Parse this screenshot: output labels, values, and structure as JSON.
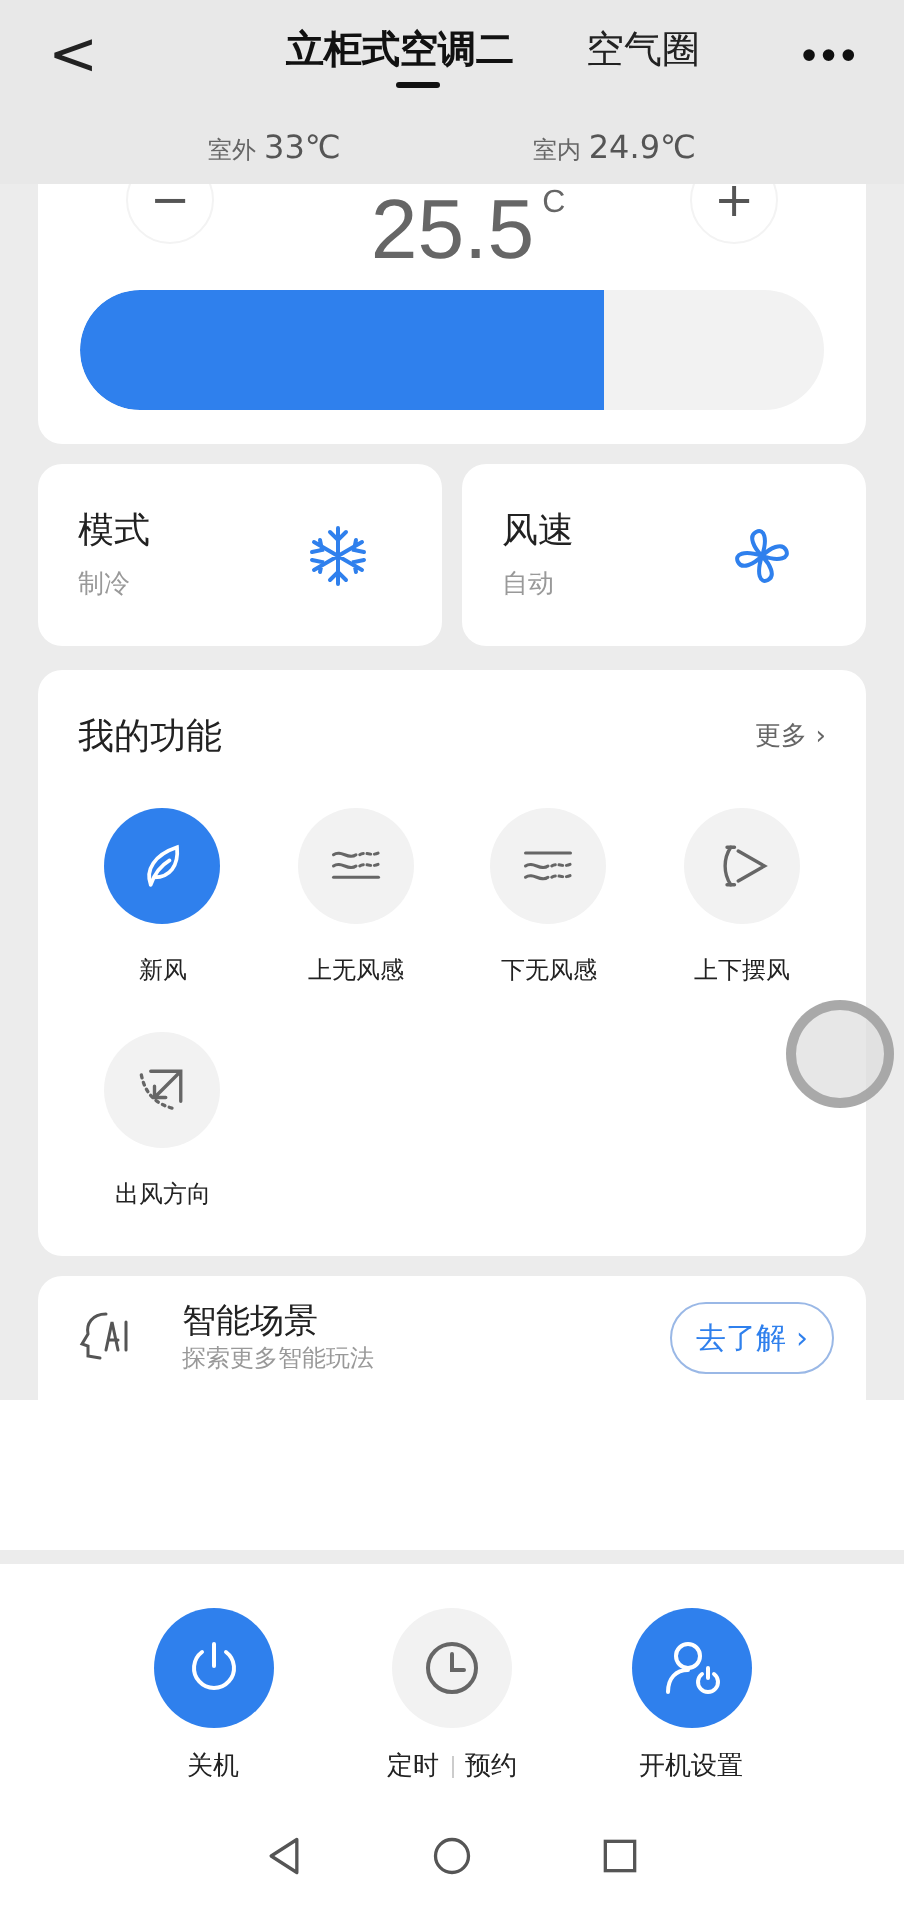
{
  "header": {
    "back": "<",
    "tabs": [
      {
        "label": "立柜式空调二",
        "selected": true
      },
      {
        "label": "空气圈",
        "selected": false
      }
    ],
    "more": "•••"
  },
  "climate": {
    "outdoor": {
      "label": "室外",
      "value": "33℃"
    },
    "indoor": {
      "label": "室内",
      "value": "24.9℃"
    }
  },
  "temperature": {
    "minus": "−",
    "value": "25.5",
    "unit": "C",
    "plus": "+",
    "level": 0.705
  },
  "mode_cards": [
    {
      "title": "模式",
      "value": "制冷"
    },
    {
      "title": "风速",
      "value": "自动"
    }
  ],
  "functions": {
    "title": "我的功能",
    "more": "更多 ›",
    "items": [
      {
        "label": "新风",
        "selected": true
      },
      {
        "label": "上无风感",
        "selected": false
      },
      {
        "label": "下无风感",
        "selected": false
      },
      {
        "label": "上下摆风",
        "selected": false
      },
      {
        "label": "出风方向",
        "selected": false
      }
    ]
  },
  "scene": {
    "title": "智能场景",
    "subtitle": "探索更多智能玩法",
    "button": "去了解 ›"
  },
  "actions": [
    {
      "label": "关机",
      "active": true
    },
    {
      "label": "定时",
      "label_2": "预约",
      "active": false
    },
    {
      "label": "开机设置",
      "active": true
    }
  ]
}
